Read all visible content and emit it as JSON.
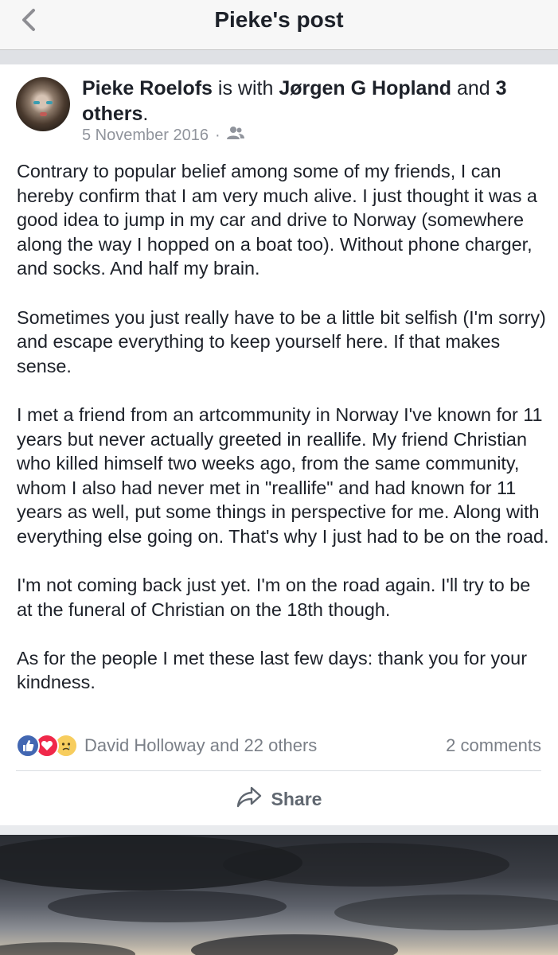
{
  "nav": {
    "title": "Pieke's post",
    "back_icon": "chevron-left-icon"
  },
  "post": {
    "author": "Pieke Roelofs",
    "with_text": "is with",
    "tagged": "Jørgen G Hopland",
    "and_text": "and",
    "others": "3 others",
    "period": ".",
    "date": "5 November 2016",
    "separator": "·",
    "audience_icon": "friends-icon",
    "paragraphs": [
      "Contrary to popular belief among some of my friends, I can hereby confirm that I am very much alive. I just thought it was a good idea to jump in my car and drive to Norway (somewhere along the way I hopped on a boat too). Without phone charger, and socks. And half my brain.",
      "Sometimes you just really have to be a little bit selfish (I'm sorry) and escape everything to keep yourself here. If that makes sense.",
      "I met a friend from an artcommunity in Norway I've known for 11 years but never actually greeted in reallife. My friend Christian who killed himself two weeks ago, from the same community, whom I also had never met in \"reallife\" and had known for 11 years as well, put some things in perspective for me. Along with everything else going on. That's why I just had to be on the road.",
      "I'm not coming back just yet. I'm on the road again. I'll try to be at the funeral of Christian on the 18th though.",
      "As for the people I met these last few days: thank you for your kindness."
    ],
    "reactions_text": "David Holloway and 22 others",
    "reaction_icons": [
      "like-icon",
      "love-icon",
      "sad-icon"
    ],
    "comments_text": "2 comments",
    "share_label": "Share"
  },
  "colors": {
    "brand_blue": "#4267b2",
    "love_red": "#f0284a",
    "sad_yellow": "#f7cd5e",
    "muted": "#90949c"
  }
}
